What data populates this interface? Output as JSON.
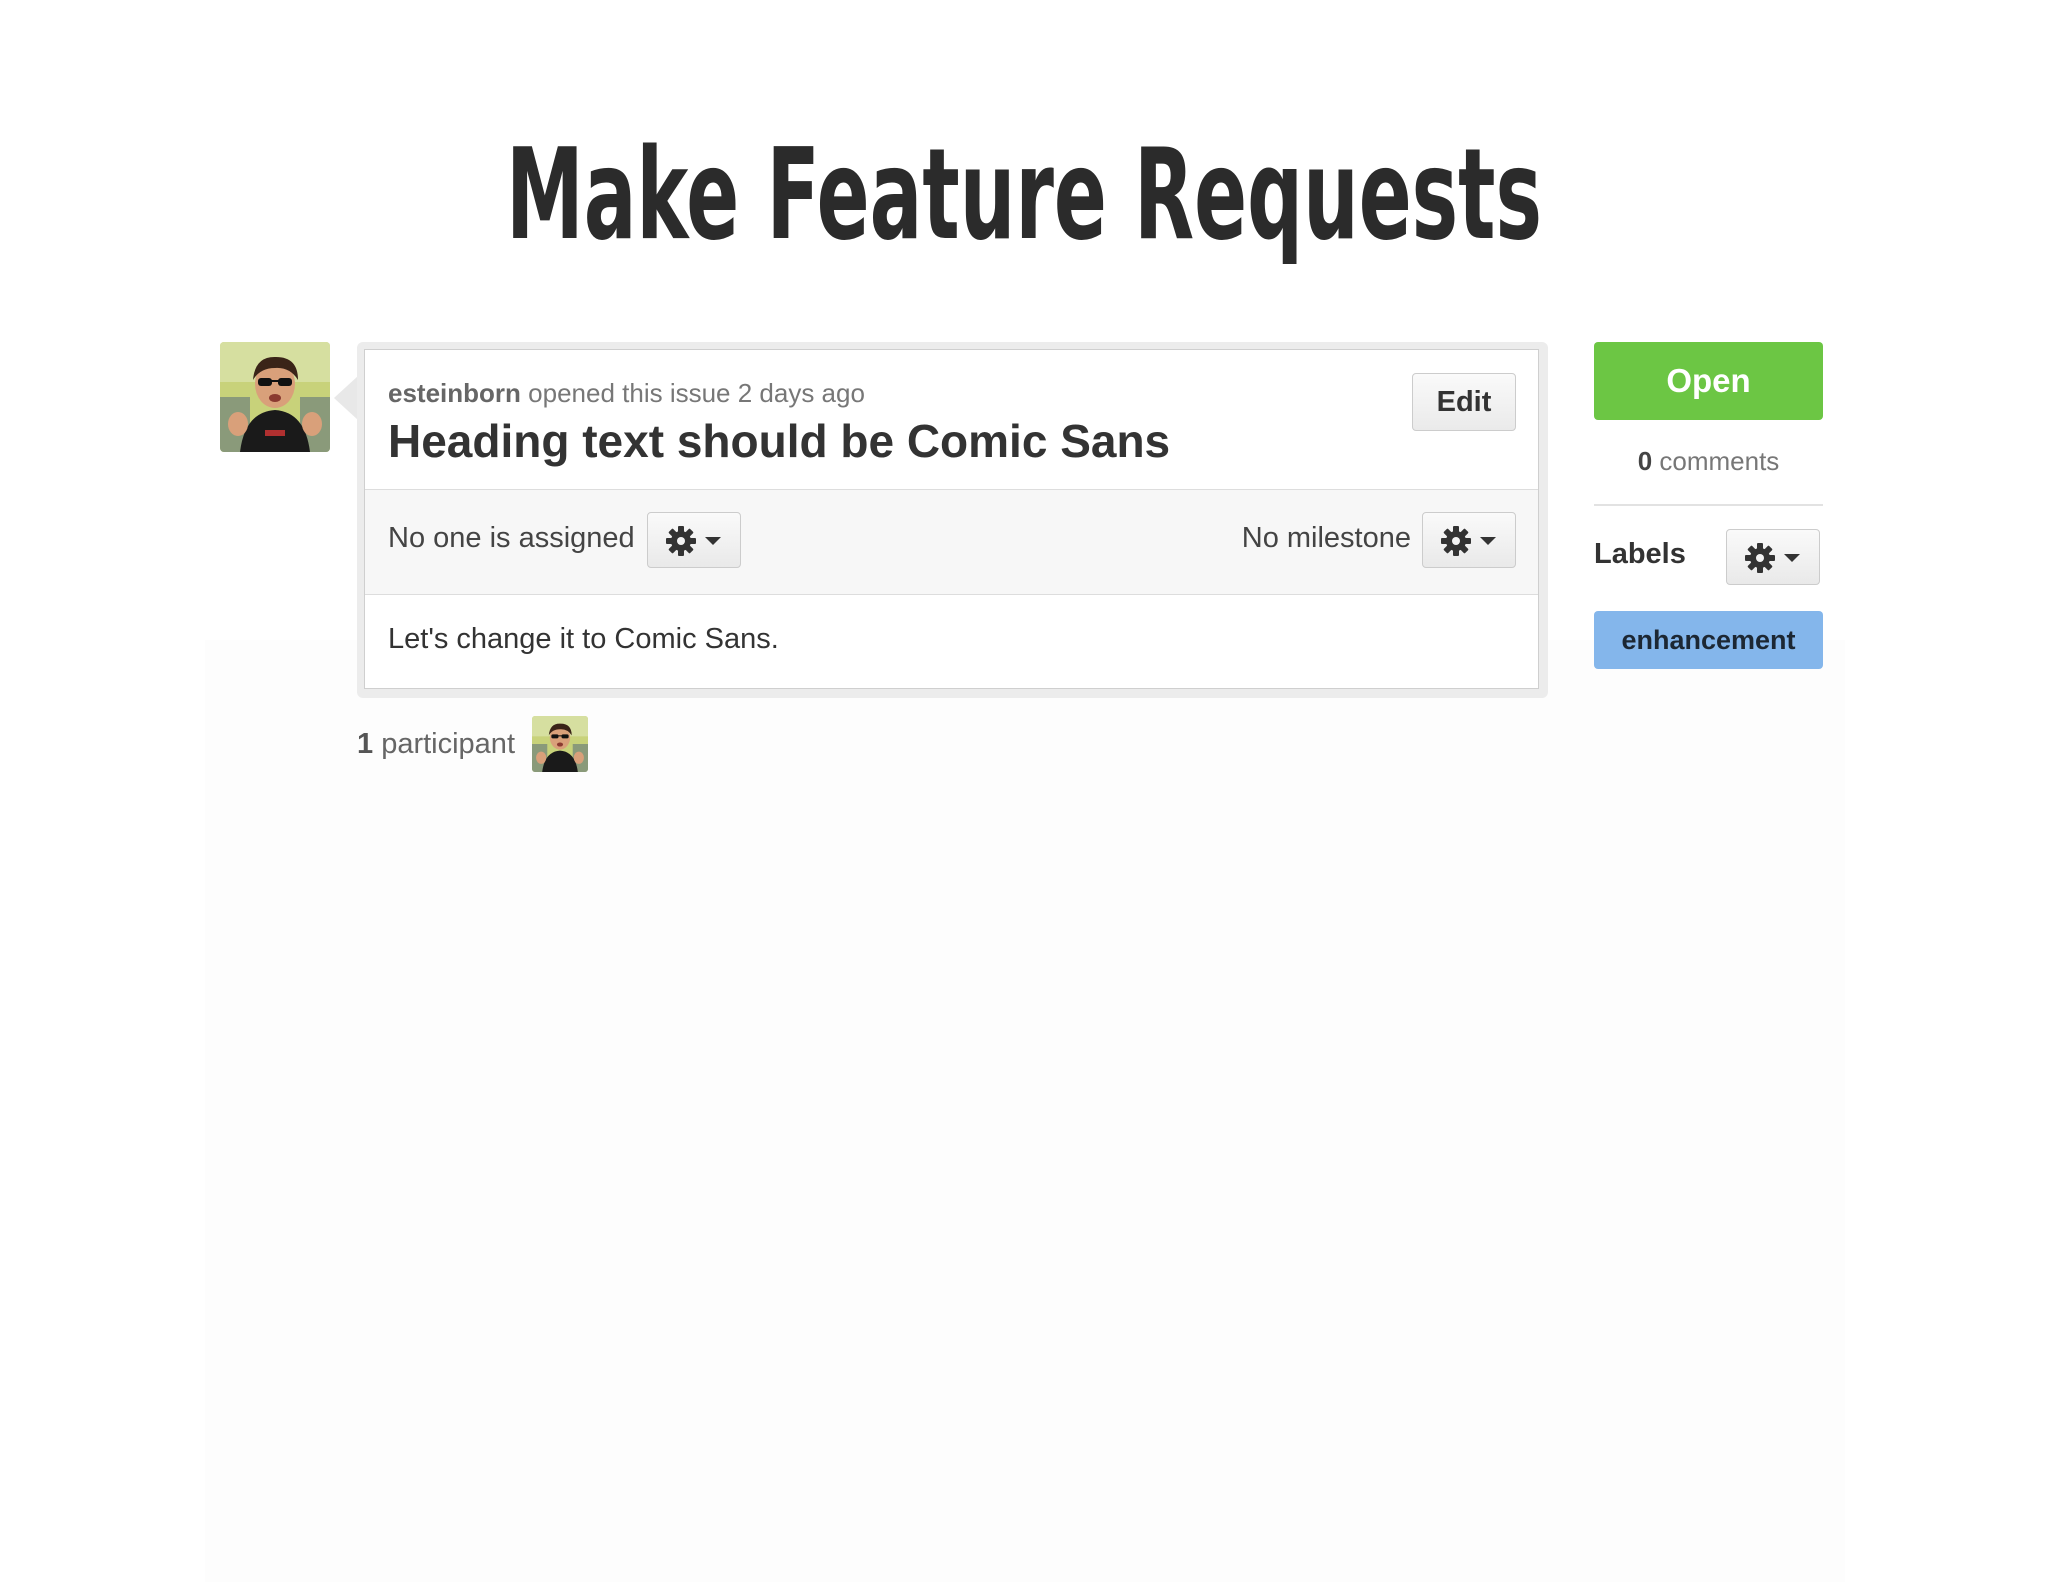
{
  "slide": {
    "title": "Make Feature Requests"
  },
  "issue": {
    "author": "esteinborn",
    "opened_text": " opened this issue 2 days ago",
    "title": "Heading text should be Comic Sans",
    "edit_label": "Edit",
    "assignee_text": "No one is assigned",
    "milestone_text": "No milestone",
    "body": "Let's change it to Comic Sans."
  },
  "participants": {
    "count": "1",
    "label": " participant"
  },
  "sidebar": {
    "status": "Open",
    "comments_count": "0",
    "comments_label": " comments",
    "labels_heading": "Labels",
    "labels": [
      "enhancement"
    ]
  },
  "colors": {
    "open_green": "#6cc644",
    "enhancement_blue": "#84b6eb"
  },
  "icons": {
    "settings": "gear-icon",
    "dropdown": "caret-down-icon"
  }
}
